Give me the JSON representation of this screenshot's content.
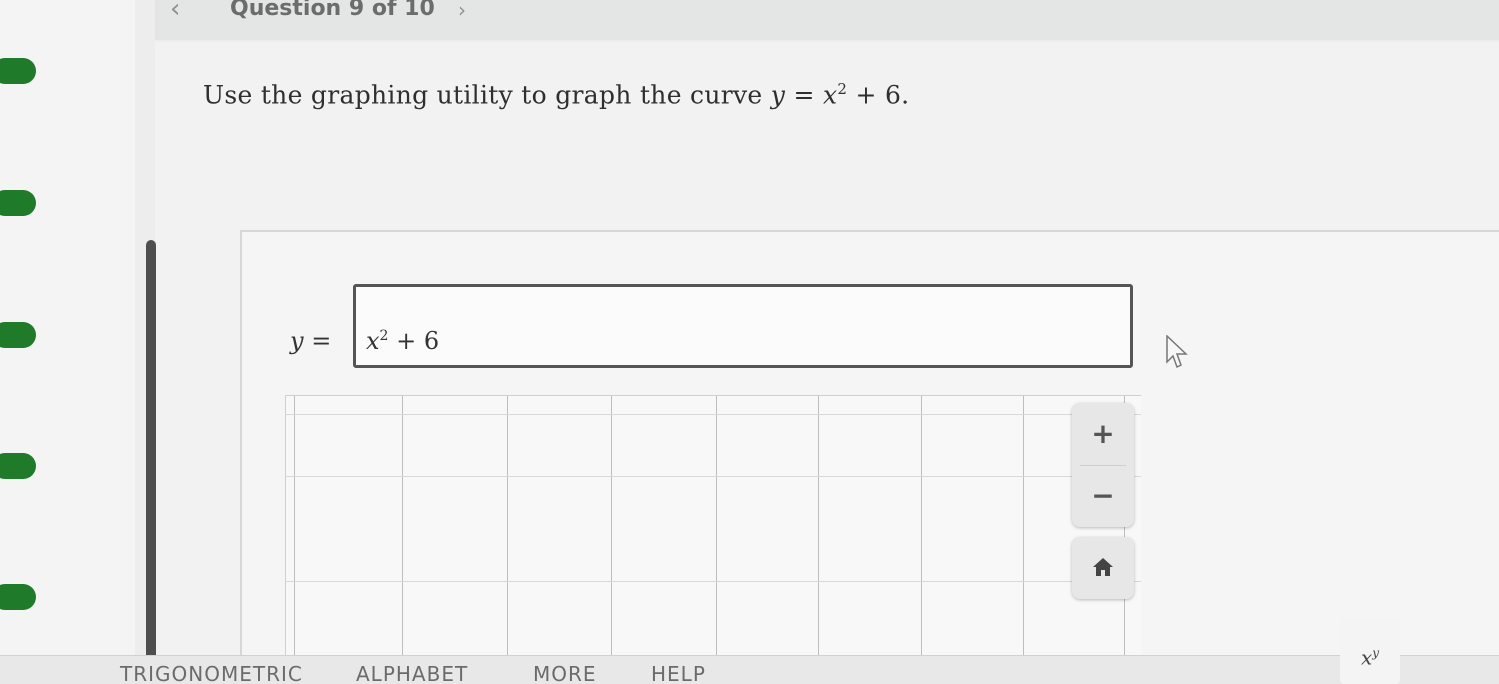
{
  "header": {
    "question_label": "Question 9 of 10",
    "prev_glyph": "‹",
    "next_glyph": "›"
  },
  "rail": {
    "accent_color": "#1f7a2a",
    "items": 5
  },
  "prompt": {
    "text_before": "Use the graphing utility to graph the curve ",
    "var_y": "y",
    "equals": " = ",
    "var_x": "x",
    "exponent": "2",
    "text_after": " + 6."
  },
  "answer": {
    "y_label": "y =",
    "input_base": "x",
    "input_exponent": "2",
    "input_rest": " + 6"
  },
  "graph": {
    "zoom_in_label": "+",
    "zoom_out_label": "−",
    "home_icon": "home-icon"
  },
  "keyboard": {
    "tabs": [
      "TRIGONOMETRIC",
      "ALPHABET",
      "MORE",
      "HELP"
    ],
    "xy_key_base": "x",
    "xy_key_exp": "y"
  }
}
